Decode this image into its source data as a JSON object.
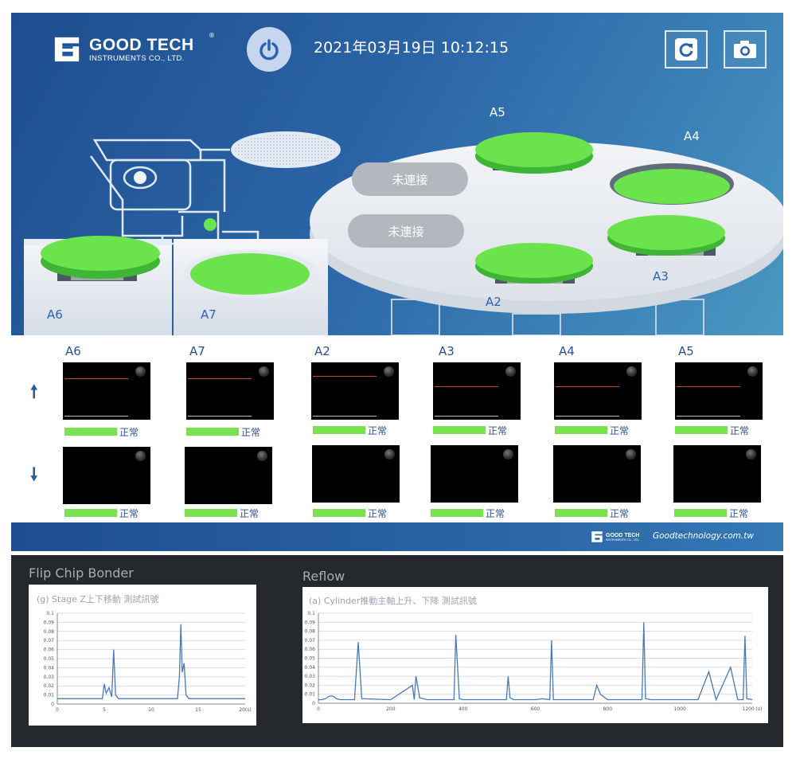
{
  "header": {
    "brand_name": "GOOD TECH",
    "brand_sub": "INSTRUMENTS CO., LTD.",
    "brand_reg": "®",
    "datetime": "2021年03月19日 10:12:15",
    "power_icon": "power-icon",
    "refresh_icon": "refresh-icon",
    "camera_icon": "camera-icon"
  },
  "machine": {
    "platforms": [
      {
        "id": "A5",
        "state": "active"
      },
      {
        "id": "A4",
        "state": "active"
      },
      {
        "id": "A3",
        "state": "active"
      },
      {
        "id": "A2",
        "state": "active"
      },
      {
        "id": "A6",
        "state": "active"
      },
      {
        "id": "A7",
        "state": "active"
      }
    ],
    "labels": {
      "A5": "A5",
      "A4": "A4",
      "A3": "A3",
      "A2": "A2",
      "A6": "A6",
      "A7": "A7"
    },
    "disconnected": [
      "未連接",
      "未連接"
    ],
    "active_color": "#6be34c"
  },
  "sensors": {
    "columns": [
      "A6",
      "A7",
      "A2",
      "A3",
      "A4",
      "A5"
    ],
    "up_arrow_icon": "arrow-up-icon",
    "down_arrow_icon": "arrow-down-icon",
    "up_status": [
      "正常",
      "正常",
      "正常",
      "正常",
      "正常",
      "正常"
    ],
    "down_status": [
      "正常",
      "正常",
      "正常",
      "正常",
      "正常",
      "正常"
    ],
    "status_color": "#79e24f"
  },
  "footer": {
    "brand_name": "GOOD TECH",
    "brand_sub": "INSTRUMENTS CO., LTD.",
    "url": "Goodtechnology.com.tw"
  },
  "charts_panel": {
    "left_title": "Flip Chip Bonder",
    "right_title": "Reflow"
  },
  "chart_data": [
    {
      "type": "line",
      "title": "(g) Stage Z上下移動 測試訊號",
      "xlabel": "(s)",
      "ylabel": "",
      "xlim": [
        0,
        20
      ],
      "ylim": [
        0,
        0.1
      ],
      "xticks": [
        "0",
        "5",
        "10",
        "15",
        "20(s)"
      ],
      "yticks": [
        "0",
        "0.01",
        "0.02",
        "0.03",
        "0.04",
        "0.05",
        "0.06",
        "0.07",
        "0.08",
        "0.09",
        "0.1"
      ],
      "grid": true,
      "series": [
        {
          "color": "#4a78b8",
          "x": [
            0,
            0.5,
            1,
            2,
            3,
            4,
            4.8,
            5.0,
            5.2,
            5.5,
            5.8,
            6.0,
            6.2,
            6.5,
            7,
            8,
            9,
            10,
            11,
            12,
            12.8,
            13.0,
            13.15,
            13.3,
            13.5,
            13.7,
            14,
            15,
            16,
            17,
            18,
            19,
            20
          ],
          "y": [
            0.006,
            0.006,
            0.006,
            0.006,
            0.006,
            0.006,
            0.006,
            0.022,
            0.012,
            0.018,
            0.008,
            0.06,
            0.01,
            0.006,
            0.006,
            0.006,
            0.006,
            0.006,
            0.006,
            0.006,
            0.006,
            0.03,
            0.088,
            0.035,
            0.045,
            0.01,
            0.006,
            0.006,
            0.006,
            0.006,
            0.006,
            0.006,
            0.006
          ]
        }
      ]
    },
    {
      "type": "line",
      "title": "(a) Cylinder推動主軸上升、下降 測試訊號",
      "xlabel": "(s)",
      "ylabel": "",
      "xlim": [
        0,
        1200
      ],
      "ylim": [
        0,
        0.1
      ],
      "xticks": [
        "0",
        "200",
        "400",
        "600",
        "800",
        "1000",
        "1200 (s)"
      ],
      "yticks": [
        "0",
        "0.01",
        "0.02",
        "0.03",
        "0.04",
        "0.05",
        "0.06",
        "0.07",
        "0.08",
        "0.09",
        "0.1"
      ],
      "grid": true,
      "series": [
        {
          "color": "#4a78b8",
          "x": [
            0,
            10,
            20,
            30,
            40,
            50,
            60,
            100,
            110,
            120,
            200,
            260,
            265,
            270,
            280,
            290,
            300,
            350,
            375,
            380,
            390,
            400,
            480,
            520,
            525,
            530,
            540,
            560,
            600,
            620,
            640,
            645,
            650,
            700,
            760,
            770,
            780,
            800,
            880,
            895,
            900,
            905,
            920,
            1000,
            1050,
            1080,
            1100,
            1140,
            1160,
            1175,
            1180,
            1185,
            1200
          ],
          "y": [
            0.004,
            0.004,
            0.005,
            0.008,
            0.008,
            0.005,
            0.004,
            0.004,
            0.068,
            0.005,
            0.004,
            0.02,
            0.004,
            0.03,
            0.006,
            0.005,
            0.004,
            0.004,
            0.004,
            0.076,
            0.005,
            0.004,
            0.004,
            0.004,
            0.03,
            0.006,
            0.004,
            0.004,
            0.004,
            0.005,
            0.004,
            0.07,
            0.004,
            0.004,
            0.004,
            0.02,
            0.01,
            0.004,
            0.004,
            0.004,
            0.09,
            0.005,
            0.004,
            0.004,
            0.004,
            0.035,
            0.004,
            0.04,
            0.004,
            0.004,
            0.075,
            0.005,
            0.004
          ]
        }
      ]
    }
  ]
}
